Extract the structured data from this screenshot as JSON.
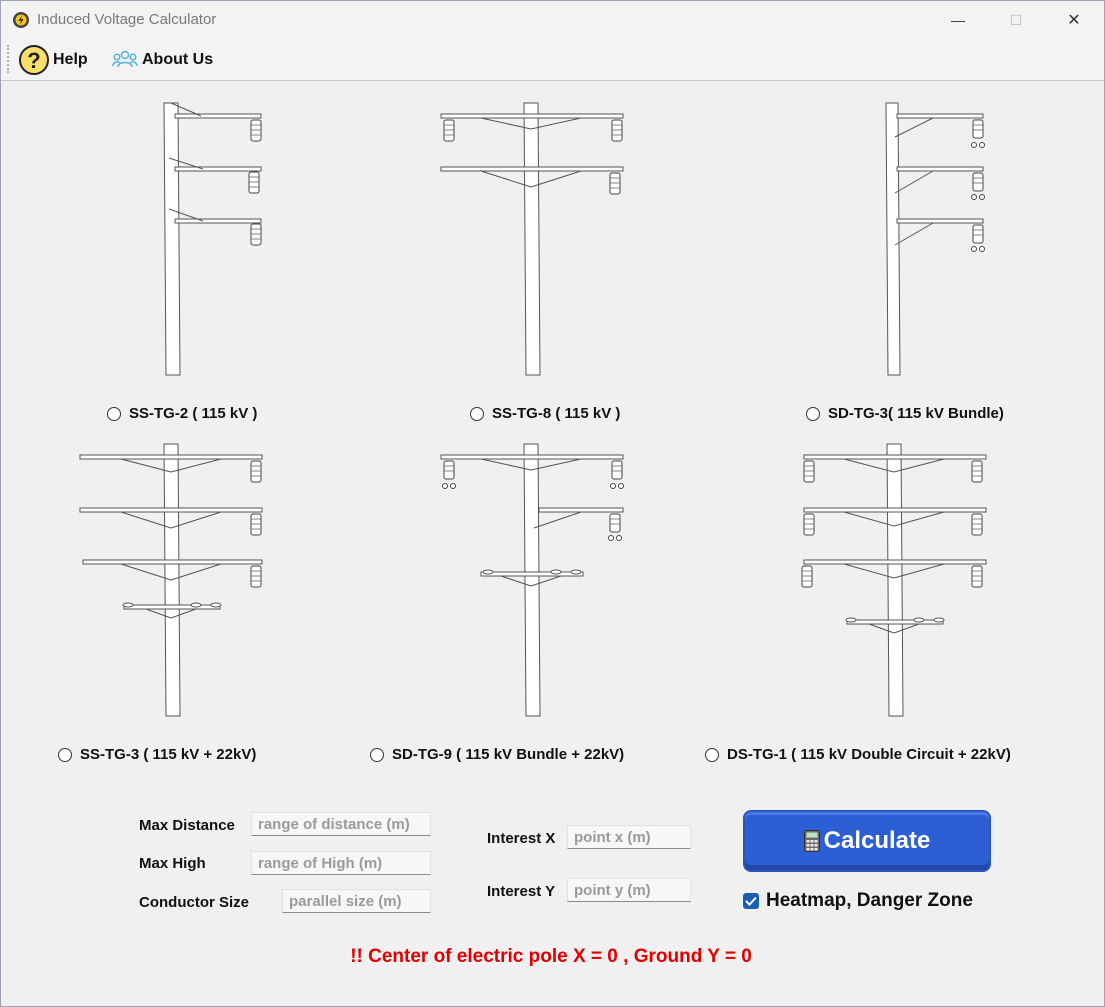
{
  "window": {
    "title": "Induced Voltage Calculator",
    "minimize_glyph": "—",
    "maximize_glyph": "☐",
    "close_glyph": "✕"
  },
  "menu": {
    "help_label": "Help",
    "about_label": "About Us"
  },
  "poles": [
    {
      "label": "SS-TG-2 ( 115 kV )",
      "selected": false
    },
    {
      "label": "SS-TG-8 ( 115 kV )",
      "selected": false
    },
    {
      "label": "SD-TG-3( 115 kV Bundle)",
      "selected": false
    },
    {
      "label": "SS-TG-3 ( 115 kV + 22kV)",
      "selected": false
    },
    {
      "label": "SD-TG-9 ( 115 kV Bundle + 22kV)",
      "selected": false
    },
    {
      "label": "DS-TG-1 ( 115 kV Double Circuit  + 22kV)",
      "selected": false
    }
  ],
  "form": {
    "max_distance": {
      "label": "Max Distance",
      "placeholder": "range of distance (m)",
      "value": ""
    },
    "max_high": {
      "label": "Max High",
      "placeholder": "range of High (m)",
      "value": ""
    },
    "conductor_size": {
      "label": "Conductor Size",
      "placeholder": "parallel size (m)",
      "value": ""
    },
    "interest_x": {
      "label": "Interest X",
      "placeholder": "point x (m)",
      "value": ""
    },
    "interest_y": {
      "label": "Interest Y",
      "placeholder": "point y (m)",
      "value": ""
    }
  },
  "calculate_label": "Calculate",
  "heatmap": {
    "label": "Heatmap, Danger Zone",
    "checked": true
  },
  "note": "!! Center of electric pole X = 0 , Ground Y = 0",
  "colors": {
    "accent_button": "#2d5fd4",
    "note_red": "#e00000",
    "checkbox_blue": "#1a5fb4"
  },
  "icons": {
    "app": "gear-lightning-icon",
    "help": "question-mark-icon",
    "about": "people-icon",
    "calculate": "calculator-icon"
  }
}
